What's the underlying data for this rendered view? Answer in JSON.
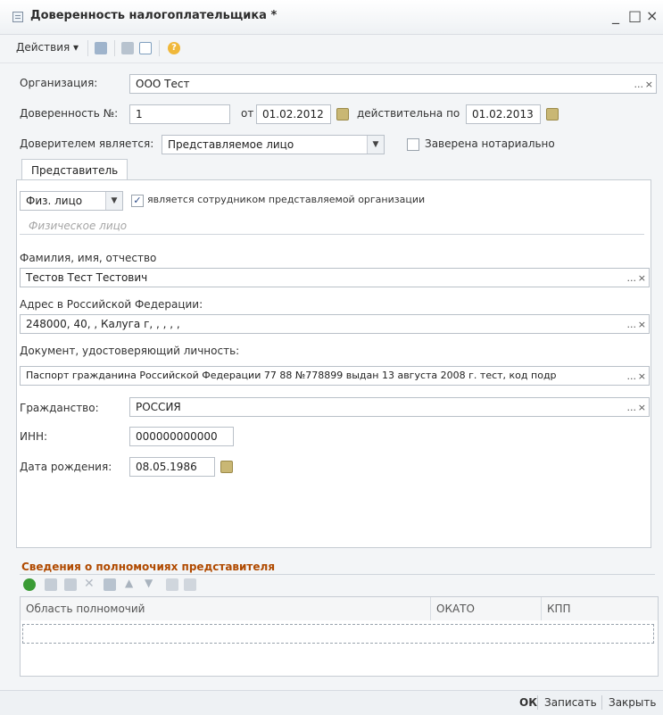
{
  "window": {
    "title": "Доверенность налогоплательщика *",
    "minimize": "_",
    "maximize": "□",
    "close": "×"
  },
  "toolbar": {
    "actions_label": "Действия ▾",
    "help_icon": "?"
  },
  "form": {
    "org_label": "Организация:",
    "org_value": "ООО Тест",
    "proxy_no_label": "Доверенность №:",
    "proxy_no_value": "1",
    "from_label": "от",
    "from_date": "01.02.2012",
    "valid_label": "действительна по",
    "valid_date": "01.02.2013",
    "trustor_label": "Доверителем является:",
    "trustor_value": "Представляемое лицо",
    "notarized_label": "Заверена нотариально",
    "notarized_checked": false
  },
  "tab": {
    "label": "Представитель"
  },
  "rep": {
    "type_value": "Физ. лицо",
    "employee_label": "является сотрудником представляемой организации",
    "employee_checked": true,
    "section_title": "Физическое лицо",
    "fio_label": "Фамилия, имя, отчество",
    "fio_value": "Тестов Тест Тестович",
    "address_label": "Адрес в Российской Федерации:",
    "address_value": "248000, 40, , Калуга г, , , , ,",
    "doc_label": "Документ, удостоверяющий личность:",
    "doc_value": "Паспорт гражданина Российской Федерации 77 88 №778899 выдан 13 августа 2008 г. тест, код подр",
    "citizenship_label": "Гражданство:",
    "citizenship_value": "РОССИЯ",
    "inn_label": "ИНН:",
    "inn_value": "000000000000",
    "birth_label": "Дата рождения:",
    "birth_value": "08.05.1986"
  },
  "powers": {
    "title": "Сведения о полномочиях представителя",
    "columns": [
      "Область полномочий",
      "ОКАТО",
      "КПП"
    ]
  },
  "footer": {
    "ok": "ОК",
    "save": "Записать",
    "close": "Закрыть"
  },
  "field_trigger": "...",
  "clear_trigger": "×",
  "colors": {
    "accent_orange": "#b04a00",
    "calendar_icon": "#c9b774",
    "add_green": "#3a9b35"
  }
}
